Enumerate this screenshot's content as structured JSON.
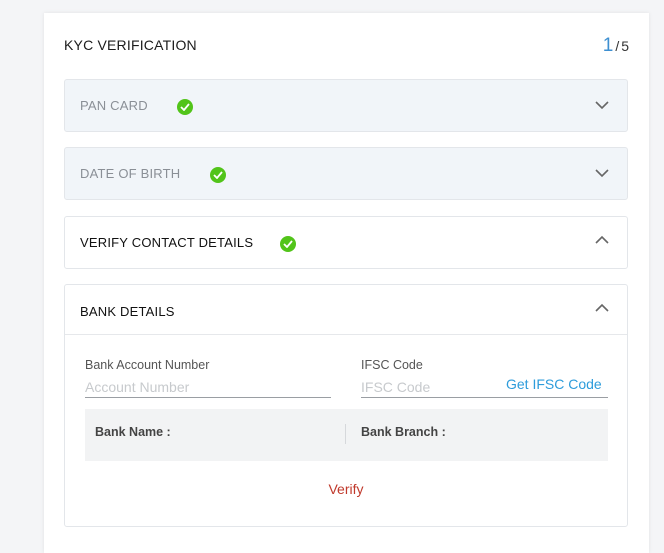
{
  "kyc": {
    "title": "KYC VERIFICATION",
    "step_current": "1",
    "step_separator": "/",
    "step_total": "5"
  },
  "sections": [
    {
      "label": "PAN CARD",
      "status": "done",
      "expanded": false
    },
    {
      "label": "DATE OF BIRTH",
      "status": "done",
      "expanded": false
    },
    {
      "label": "VERIFY CONTACT DETAILS",
      "status": "done",
      "expanded": true
    },
    {
      "label": "BANK DETAILS",
      "status": "pending",
      "expanded": true
    }
  ],
  "bank": {
    "account_label": "Bank Account Number",
    "account_placeholder": "Account Number",
    "account_value": "",
    "ifsc_label": "IFSC Code",
    "ifsc_placeholder": "IFSC Code",
    "ifsc_value": "",
    "get_ifsc_link": "Get IFSC Code",
    "bank_name_label": "Bank Name :",
    "bank_branch_label": "Bank Branch :",
    "verify_label": "Verify"
  },
  "icons": {
    "check": "check-circle-icon",
    "collapsed": "chevron-down-icon",
    "expanded": "chevron-up-icon"
  },
  "colors": {
    "accent": "#3d8fd1",
    "success": "#52c41a",
    "link": "#2d9cdb",
    "verify": "#c0392b",
    "done_bg": "#f1f5f9"
  }
}
